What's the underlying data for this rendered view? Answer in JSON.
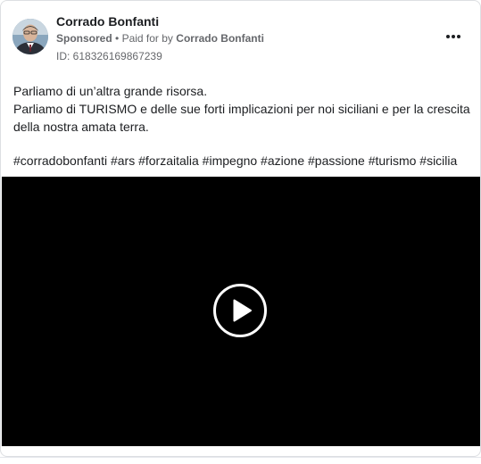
{
  "post": {
    "author": "Corrado Bonfanti",
    "sponsored_label": "Sponsored",
    "separator": "•",
    "paid_for_prefix": "Paid for by",
    "paid_for_name": "Corrado Bonfanti",
    "ad_id": "ID: 618326169867239",
    "body_lines": [
      "Parliamo di un’altra grande risorsa.",
      "Parliamo di TURISMO e delle sue forti implicazioni per noi siciliani e per la crescita della nostra amata terra."
    ],
    "hashtags": "#corradobonfanti #ars #forzaitalia #impegno #azione #passione #turismo #sicilia"
  },
  "icons": {
    "more": "more-options-icon",
    "play": "play-icon"
  },
  "colors": {
    "text": "#1c1e21",
    "muted": "#65676b",
    "video_bg": "#000000"
  }
}
